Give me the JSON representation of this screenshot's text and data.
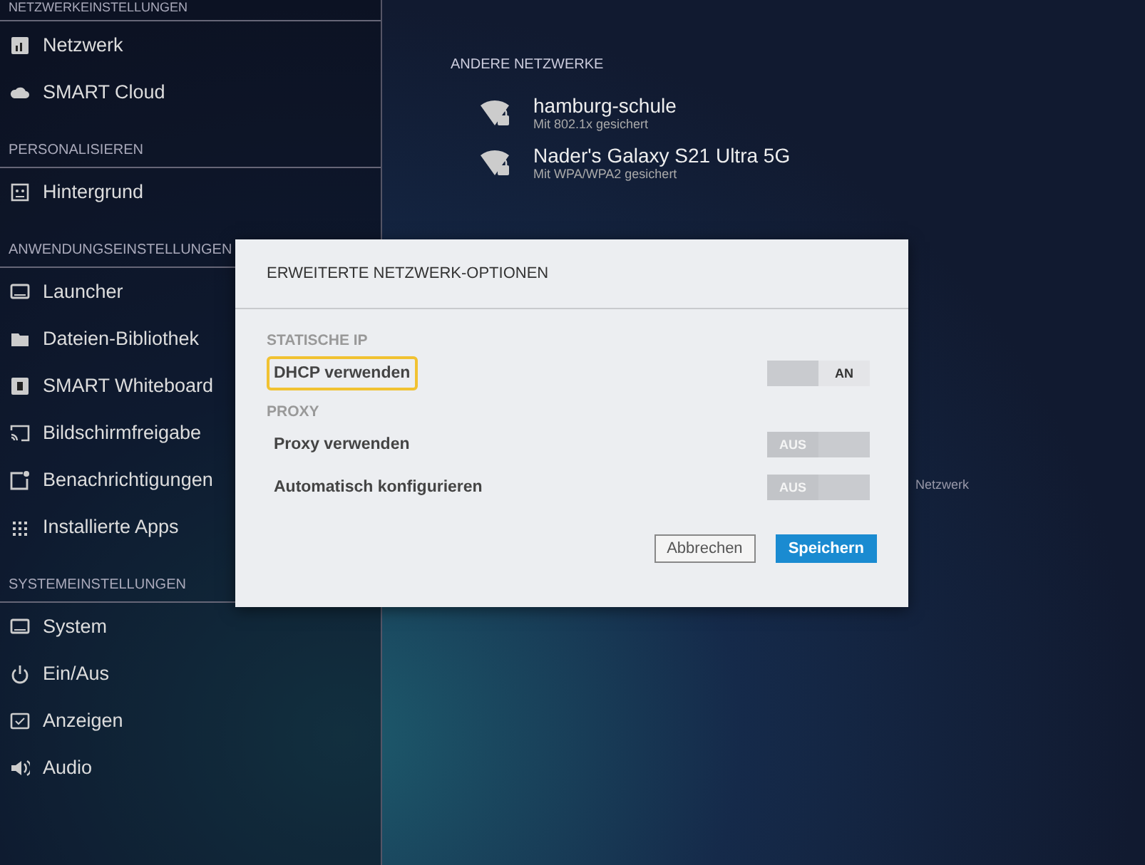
{
  "sidebar": {
    "sections": [
      {
        "title": "NETZWERKEINSTELLUNGEN",
        "items": [
          {
            "label": "Netzwerk",
            "kind": "network"
          },
          {
            "label": "SMART Cloud",
            "kind": "cloud"
          }
        ]
      },
      {
        "title": "PERSONALISIEREN",
        "items": [
          {
            "label": "Hintergrund",
            "kind": "image"
          }
        ]
      },
      {
        "title": "ANWENDUNGSEINSTELLUNGEN",
        "items": [
          {
            "label": "Launcher",
            "kind": "monitor"
          },
          {
            "label": "Dateien-Bibliothek",
            "kind": "folder"
          },
          {
            "label": "SMART Whiteboard",
            "kind": "board"
          },
          {
            "label": "Bildschirmfreigabe",
            "kind": "cast"
          },
          {
            "label": "Benachrichtigungen",
            "kind": "notify"
          },
          {
            "label": "Installierte Apps",
            "kind": "grid"
          }
        ]
      },
      {
        "title": "SYSTEMEINSTELLUNGEN",
        "items": [
          {
            "label": "System",
            "kind": "monitor"
          },
          {
            "label": "Ein/Aus",
            "kind": "power"
          },
          {
            "label": "Anzeigen",
            "kind": "display"
          },
          {
            "label": "Audio",
            "kind": "audio"
          }
        ]
      }
    ]
  },
  "networks": {
    "title": "ANDERE NETZWERKE",
    "items": [
      {
        "name": "hamburg-schule",
        "security": "Mit 802.1x gesichert"
      },
      {
        "name": "Nader's Galaxy S21 Ultra 5G",
        "security": "Mit WPA/WPA2 gesichert"
      }
    ],
    "action": "Netzwerk"
  },
  "dialog": {
    "title": "ERWEITERTE NETZWERK-OPTIONEN",
    "sections": [
      {
        "title": "STATISCHE IP",
        "options": [
          {
            "label": "DHCP verwenden",
            "on": true,
            "state_label": "AN",
            "highlighted": true
          }
        ]
      },
      {
        "title": "PROXY",
        "options": [
          {
            "label": "Proxy verwenden",
            "on": false,
            "state_label": "AUS",
            "highlighted": false
          },
          {
            "label": "Automatisch konfigurieren",
            "on": false,
            "state_label": "AUS",
            "highlighted": false
          }
        ]
      }
    ],
    "buttons": [
      {
        "label": "Abbrechen",
        "kind": "secondary"
      },
      {
        "label": "Speichern",
        "kind": "primary"
      }
    ]
  }
}
